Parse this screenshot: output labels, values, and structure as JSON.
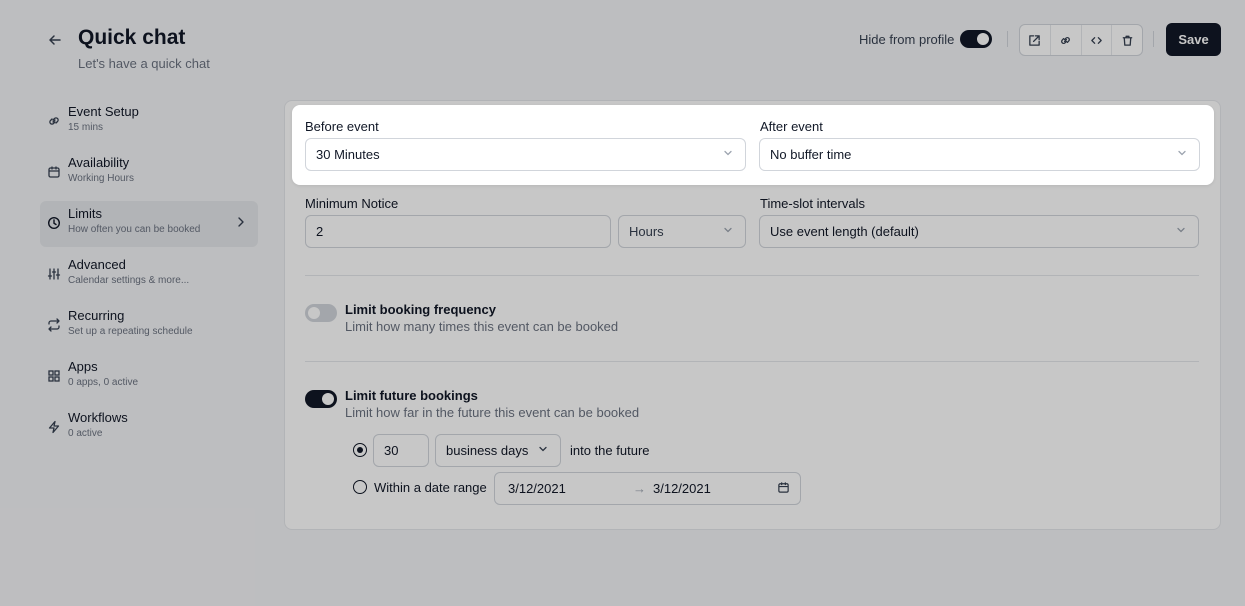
{
  "header": {
    "title": "Quick chat",
    "subtitle": "Let's have a quick chat",
    "hide_from_profile_label": "Hide from profile",
    "hide_from_profile_on": true,
    "save_label": "Save",
    "icons": [
      "external-link-icon",
      "link-icon",
      "code-icon",
      "trash-icon"
    ]
  },
  "sidebar": {
    "items": [
      {
        "label": "Event Setup",
        "sub": "15 mins",
        "icon": "link-icon"
      },
      {
        "label": "Availability",
        "sub": "Working Hours",
        "icon": "calendar-icon"
      },
      {
        "label": "Limits",
        "sub": "How often you can be booked",
        "icon": "clock-icon",
        "active": true
      },
      {
        "label": "Advanced",
        "sub": "Calendar settings & more...",
        "icon": "sliders-icon"
      },
      {
        "label": "Recurring",
        "sub": "Set up a repeating schedule",
        "icon": "repeat-icon"
      },
      {
        "label": "Apps",
        "sub": "0 apps, 0 active",
        "icon": "grid-icon"
      },
      {
        "label": "Workflows",
        "sub": "0 active",
        "icon": "zap-icon"
      }
    ]
  },
  "buffer": {
    "before_label": "Before event",
    "before_value": "30 Minutes",
    "after_label": "After event",
    "after_value": "No buffer time"
  },
  "notice": {
    "label": "Minimum Notice",
    "value": "2",
    "unit": "Hours",
    "slot_label": "Time-slot intervals",
    "slot_value": "Use event length (default)"
  },
  "frequency": {
    "title": "Limit booking frequency",
    "sub": "Limit how many times this event can be booked",
    "enabled": false
  },
  "future": {
    "title": "Limit future bookings",
    "sub": "Limit how far in the future this event can be booked",
    "enabled": true,
    "days_value": "30",
    "days_unit": "business days",
    "into_future": "into the future",
    "range_label": "Within a date range",
    "range_start": "3/12/2021",
    "range_arrow": "→",
    "range_end": "3/12/2021"
  }
}
